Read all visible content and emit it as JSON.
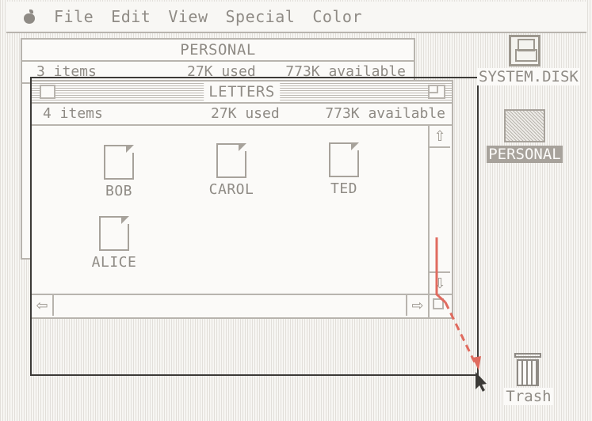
{
  "menubar": {
    "items": [
      "File",
      "Edit",
      "View",
      "Special",
      "Color"
    ]
  },
  "back_window": {
    "title": "PERSONAL",
    "info": {
      "items": "3 items",
      "used": "27K used",
      "available": "773K available"
    }
  },
  "front_window": {
    "title": "LETTERS",
    "info": {
      "items": "4 items",
      "used": "27K used",
      "available": "773K available"
    },
    "documents": [
      "BOB",
      "CAROL",
      "TED",
      "ALICE"
    ]
  },
  "desktop": {
    "icons": [
      {
        "label": "SYSTEM.DISK",
        "icon": "floppy-disk-icon"
      },
      {
        "label": "PERSONAL",
        "icon": "volume-icon"
      },
      {
        "label": "Trash",
        "icon": "trash-icon"
      }
    ]
  },
  "colors": {
    "drag_arrow": "#e06b5f",
    "resize_outline": "#3c3a37",
    "ui_gray": "#b8b4ae"
  }
}
